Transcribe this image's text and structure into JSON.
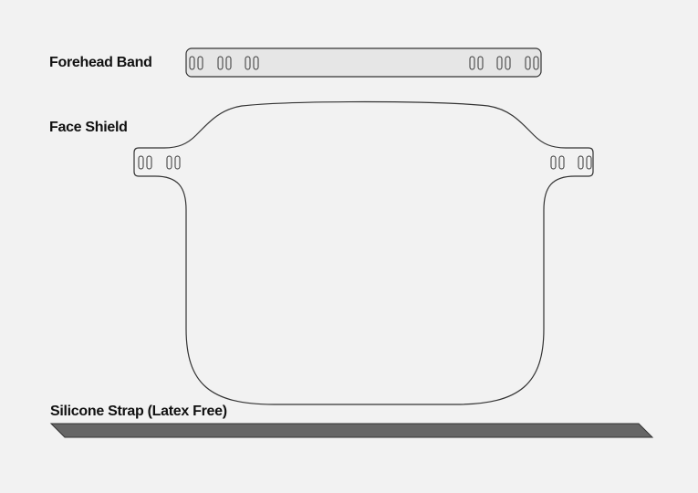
{
  "labels": {
    "forehead_band": "Forehead Band",
    "face_shield": "Face Shield",
    "strap": "Silicone Strap (Latex Free)"
  },
  "colors": {
    "background": "#f2f2f2",
    "outline": "#333333",
    "band_fill": "#e6e6e6",
    "strap_fill": "#666666"
  }
}
